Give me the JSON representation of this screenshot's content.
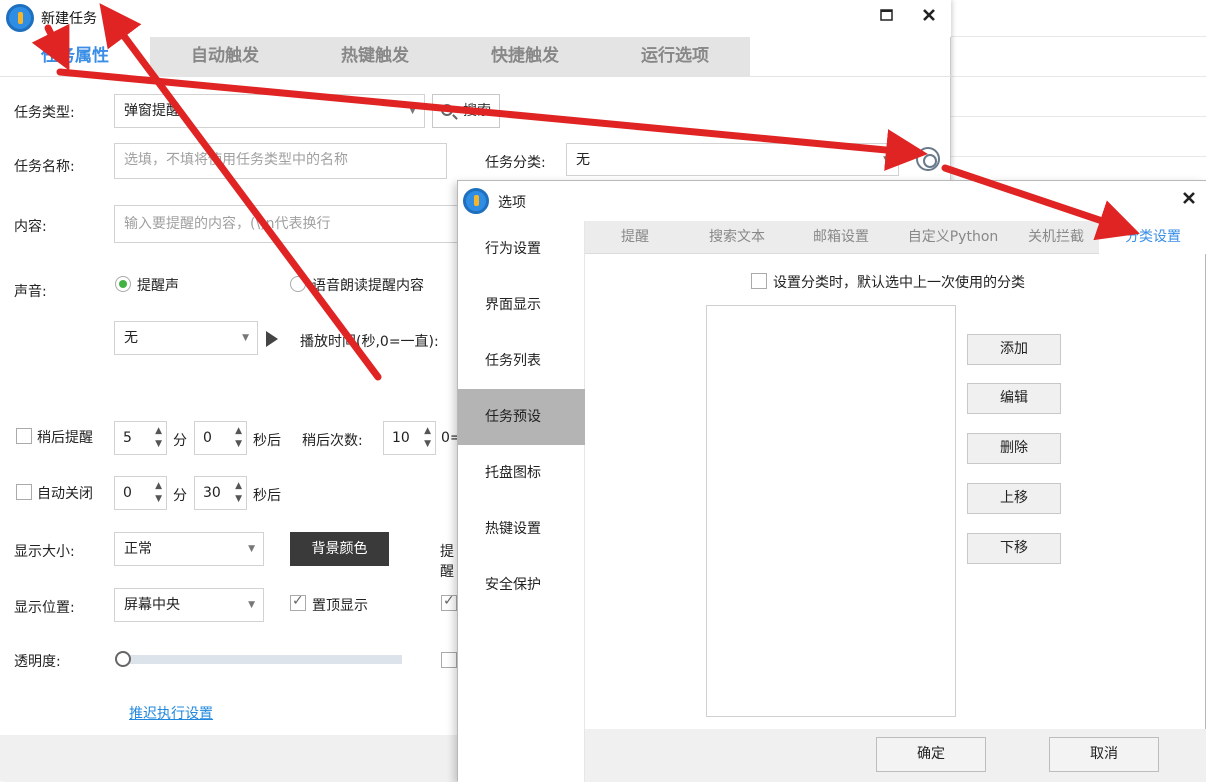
{
  "main_window": {
    "title": "新建任务",
    "maximize_icon": "maximize-icon",
    "close_icon": "close-icon",
    "tabs": [
      {
        "label": "任务属性",
        "active": true
      },
      {
        "label": "自动触发",
        "active": false
      },
      {
        "label": "热键触发",
        "active": false
      },
      {
        "label": "快捷触发",
        "active": false
      },
      {
        "label": "运行选项",
        "active": false
      }
    ],
    "form": {
      "task_type_label": "任务类型:",
      "task_type_value": "弹窗提醒",
      "search_label": "搜索",
      "task_name_label": "任务名称:",
      "task_name_placeholder": "选填，不填将使用任务类型中的名称",
      "category_label": "任务分类:",
      "category_value": "无",
      "content_label": "内容:",
      "content_placeholder": "输入要提醒的内容，(\\)n代表换行",
      "sound_label": "声音:",
      "sound_option_1": "提醒声",
      "sound_option_2": "语音朗读提醒内容",
      "sound_select_value": "无",
      "play_time_label": "播放时间(秒,0=一直):",
      "snooze_label": "稍后提醒",
      "snooze_min_value": "5",
      "snooze_min_unit": "分",
      "snooze_sec_value": "0",
      "snooze_sec_unit": "秒后",
      "snooze_count_label": "稍后次数:",
      "snooze_count_value": "10",
      "snooze_count_hint": "0=",
      "autoclose_label": "自动关闭",
      "autoclose_min_value": "0",
      "autoclose_min_unit": "分",
      "autoclose_sec_value": "30",
      "autoclose_sec_unit": "秒后",
      "display_size_label": "显示大小:",
      "display_size_value": "正常",
      "bg_color_label": "背景颜色",
      "reminder_cut_label": "提醒",
      "display_pos_label": "显示位置:",
      "display_pos_value": "屏幕中央",
      "topmost_label": "置顶显示",
      "topmost_checked": true,
      "opacity_label": "透明度:",
      "opacity_value": 0,
      "delay_link": "推迟执行设置"
    }
  },
  "options_dialog": {
    "title": "选项",
    "close_icon": "close-icon",
    "sidebar": [
      {
        "label": "行为设置",
        "active": false
      },
      {
        "label": "界面显示",
        "active": false
      },
      {
        "label": "任务列表",
        "active": false
      },
      {
        "label": "任务预设",
        "active": true
      },
      {
        "label": "托盘图标",
        "active": false
      },
      {
        "label": "热键设置",
        "active": false
      },
      {
        "label": "安全保护",
        "active": false
      }
    ],
    "tabs": [
      {
        "label": "提醒",
        "active": false
      },
      {
        "label": "搜索文本",
        "active": false
      },
      {
        "label": "邮箱设置",
        "active": false
      },
      {
        "label": "自定义Python",
        "active": false
      },
      {
        "label": "关机拦截",
        "active": false
      },
      {
        "label": "分类设置",
        "active": true
      }
    ],
    "remember_category_label": "设置分类时，默认选中上一次使用的分类",
    "remember_category_checked": false,
    "buttons": {
      "add": "添加",
      "edit": "编辑",
      "delete": "删除",
      "move_up": "上移",
      "move_down": "下移"
    },
    "ok": "确定",
    "cancel": "取消"
  },
  "colors": {
    "accent": "#3a8ee6",
    "annotation_arrow": "#e02424",
    "bg_color_button": "#3a3a3a"
  }
}
